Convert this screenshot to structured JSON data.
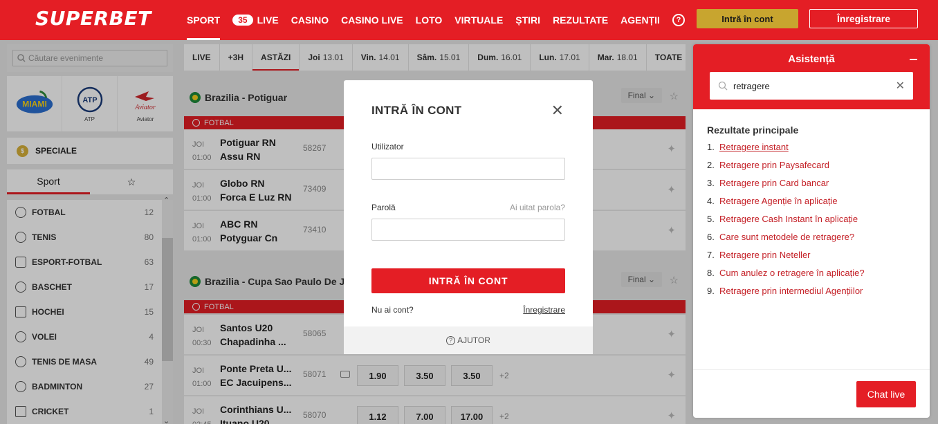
{
  "header": {
    "logo": "SUPERBET",
    "nav": [
      {
        "label": "SPORT"
      },
      {
        "label": "LIVE",
        "badge": "35"
      },
      {
        "label": "CASINO"
      },
      {
        "label": "CASINO LIVE"
      },
      {
        "label": "LOTO"
      },
      {
        "label": "VIRTUALE"
      },
      {
        "label": "ȘTIRI"
      },
      {
        "label": "REZULTATE"
      },
      {
        "label": "AGENȚII"
      }
    ],
    "help_glyph": "?",
    "login_label": "Intră în cont",
    "register_label": "Înregistrare"
  },
  "sidebar": {
    "search_placeholder": "Căutare evenimente",
    "tiles": [
      {
        "label": "",
        "art": "MIAMI"
      },
      {
        "label": "ATP",
        "art": "ATP"
      },
      {
        "label": "Aviator",
        "art": "Aviator"
      }
    ],
    "speciale": "SPECIALE",
    "tabs": {
      "sport": "Sport",
      "fav_glyph": "☆"
    },
    "sports": [
      {
        "name": "FOTBAL",
        "count": "12"
      },
      {
        "name": "TENIS",
        "count": "80"
      },
      {
        "name": "ESPORT-FOTBAL",
        "count": "63"
      },
      {
        "name": "BASCHET",
        "count": "17"
      },
      {
        "name": "HOCHEI",
        "count": "15"
      },
      {
        "name": "VOLEI",
        "count": "4"
      },
      {
        "name": "TENIS DE MASA",
        "count": "49"
      },
      {
        "name": "BADMINTON",
        "count": "27"
      },
      {
        "name": "CRICKET",
        "count": "1"
      }
    ]
  },
  "datebar": {
    "items": [
      {
        "label": "LIVE",
        "date": ""
      },
      {
        "label": "+3H",
        "date": ""
      },
      {
        "label": "ASTĂZI",
        "date": ""
      },
      {
        "label": "Joi",
        "date": "13.01"
      },
      {
        "label": "Vin.",
        "date": "14.01"
      },
      {
        "label": "Sâm.",
        "date": "15.01"
      },
      {
        "label": "Dum.",
        "date": "16.01"
      },
      {
        "label": "Lun.",
        "date": "17.01"
      },
      {
        "label": "Mar.",
        "date": "18.01"
      },
      {
        "label": "TOATE",
        "date": ""
      }
    ]
  },
  "leagues": [
    {
      "name": "Brazilia - Potiguar",
      "filter": "Final",
      "sport": "FOTBAL"
    },
    {
      "name": "Brazilia - Cupa Sao Paulo De J",
      "filter": "Final",
      "sport": "FOTBAL"
    }
  ],
  "events": [
    {
      "day": "JOI",
      "time": "01:00",
      "home": "Potiguar RN",
      "away": "Assu RN",
      "code": "58267"
    },
    {
      "day": "JOI",
      "time": "01:00",
      "home": "Globo RN",
      "away": "Forca E Luz RN",
      "code": "73409"
    },
    {
      "day": "JOI",
      "time": "01:00",
      "home": "ABC RN",
      "away": "Potyguar Cn",
      "code": "73410"
    },
    {
      "day": "JOI",
      "time": "00:30",
      "home": "Santos U20",
      "away": "Chapadinha ...",
      "code": "58065"
    },
    {
      "day": "JOI",
      "time": "01:00",
      "home": "Ponte Preta U...",
      "away": "EC Jacuipens...",
      "code": "58071",
      "odds": [
        "1.90",
        "3.50",
        "3.50"
      ],
      "more": "+2"
    },
    {
      "day": "JOI",
      "time": "02:45",
      "home": "Corinthians U...",
      "away": "Ituano U20",
      "code": "58070",
      "odds": [
        "1.12",
        "7.00",
        "17.00"
      ],
      "more": "+2"
    }
  ],
  "modal": {
    "title": "INTRĂ ÎN CONT",
    "close_glyph": "✕",
    "user_label": "Utilizator",
    "pass_label": "Parolă",
    "forgot": "Ai uitat parola?",
    "submit": "INTRĂ ÎN CONT",
    "no_account": "Nu ai cont?",
    "register": "Înregistrare",
    "help": "AJUTOR"
  },
  "help_panel": {
    "title": "Asistență",
    "search_value": "retragere",
    "results_title": "Rezultate principale",
    "results": [
      "Retragere instant",
      "Retragere prin Paysafecard",
      "Retragere prin Card bancar",
      "Retragere Agenție în aplicație",
      "Retragere Cash Instant în aplicație",
      "Care sunt metodele de retragere?",
      "Retragere prin Neteller",
      "Cum anulez o retragere în aplicație?",
      "Retragere prin intermediul Agențiilor"
    ],
    "chat_label": "Chat live"
  },
  "colors": {
    "brand": "#e41e25",
    "gold": "#c8a52f"
  }
}
